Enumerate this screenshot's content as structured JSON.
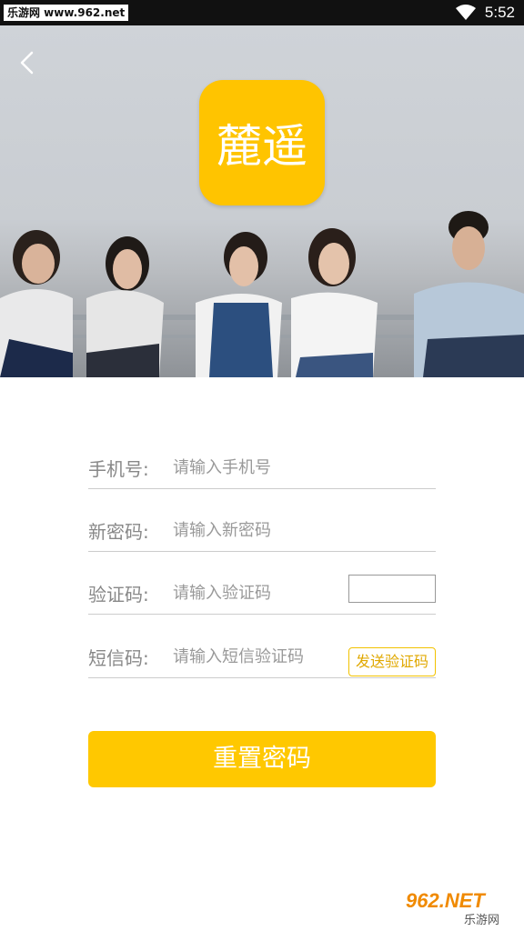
{
  "status_bar": {
    "source_label": "乐游网 www.962.net",
    "time": "5:52",
    "wifi_icon": "wifi-icon"
  },
  "header": {
    "back_icon": "chevron-left-icon",
    "app_logo_text": "麓遥"
  },
  "form": {
    "phone": {
      "label": "手机号:",
      "placeholder": "请输入手机号"
    },
    "new_password": {
      "label": "新密码:",
      "placeholder": "请输入新密码"
    },
    "captcha": {
      "label": "验证码:",
      "placeholder": "请输入验证码"
    },
    "sms_code": {
      "label": "短信码:",
      "placeholder": "请输入短信验证码",
      "send_button": "发送验证码"
    }
  },
  "submit": {
    "label": "重置密码"
  },
  "colors": {
    "accent": "#ffc800",
    "label_gray": "#888888",
    "divider": "#cccccc"
  },
  "watermark": {
    "text": "962.NET",
    "subtext": "乐游网"
  }
}
